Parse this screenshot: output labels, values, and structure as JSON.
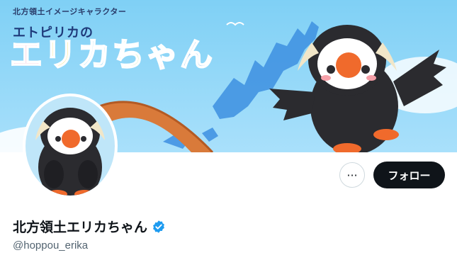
{
  "banner": {
    "tagline": "北方領土イメージキャラクター",
    "subtitle": "エトピリカの",
    "title_chars": [
      "エ",
      "リ",
      "カ",
      "ち",
      "ゃ",
      "ん"
    ],
    "title_colors": [
      "#f3a6c8",
      "#f6e27a",
      "#9ad7f3",
      "#b8e39a",
      "#f7b8d0",
      "#9ecbf1"
    ]
  },
  "profile": {
    "display_name": "北方領土エリカちゃん",
    "handle": "@hoppou_erika",
    "verified": true
  },
  "actions": {
    "more_label": "···",
    "follow_label": "フォロー"
  },
  "colors": {
    "follow_bg": "#0f1419",
    "verified_blue": "#1d9bf0"
  }
}
